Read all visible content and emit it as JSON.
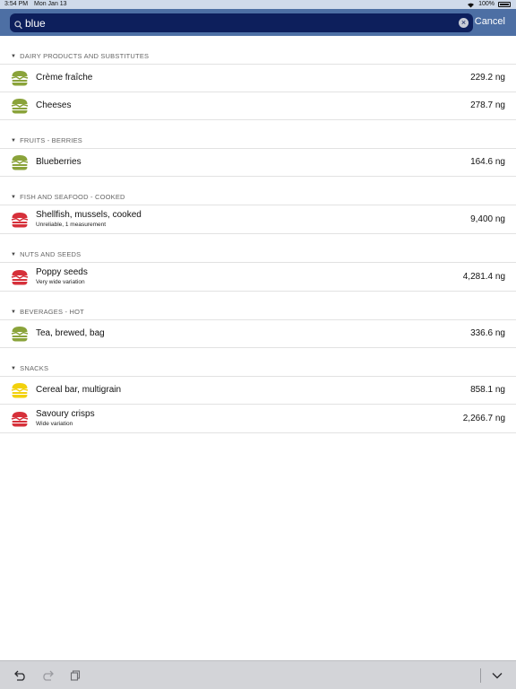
{
  "status": {
    "time": "3:54 PM",
    "date": "Mon Jan 13",
    "battery": "100%"
  },
  "search": {
    "query": "blue",
    "cancel_label": "Cancel"
  },
  "colors": {
    "nav": "#4d6fa4",
    "search_bg": "#0d1f5c",
    "green": "#8aa33a",
    "red": "#d6303a",
    "yellow": "#f2d10c"
  },
  "sections": [
    {
      "title": "DAIRY PRODUCTS AND SUBSTITUTES",
      "items": [
        {
          "name": "Crème fraîche",
          "sub": "",
          "value": "229.2 ng",
          "icon": "burger-green-icon"
        },
        {
          "name": "Cheeses",
          "sub": "",
          "value": "278.7 ng",
          "icon": "burger-green-icon"
        }
      ]
    },
    {
      "title": "FRUITS - BERRIES",
      "items": [
        {
          "name": "Blueberries",
          "sub": "",
          "value": "164.6 ng",
          "icon": "burger-green-icon"
        }
      ]
    },
    {
      "title": "FISH AND SEAFOOD - COOKED",
      "items": [
        {
          "name": "Shellfish, mussels, cooked",
          "sub": "Unreliable, 1 measurement",
          "value": "9,400 ng",
          "icon": "burger-red-icon"
        }
      ]
    },
    {
      "title": "NUTS AND SEEDS",
      "items": [
        {
          "name": "Poppy seeds",
          "sub": "Very wide variation",
          "value": "4,281.4 ng",
          "icon": "burger-red-icon"
        }
      ]
    },
    {
      "title": "BEVERAGES - HOT",
      "items": [
        {
          "name": "Tea, brewed, bag",
          "sub": "",
          "value": "336.6 ng",
          "icon": "burger-green-icon"
        }
      ]
    },
    {
      "title": "SNACKS",
      "items": [
        {
          "name": "Cereal bar, multigrain",
          "sub": "",
          "value": "858.1 ng",
          "icon": "burger-yellow-icon"
        },
        {
          "name": "Savoury crisps",
          "sub": "Wide variation",
          "value": "2,266.7 ng",
          "icon": "burger-red-icon"
        }
      ]
    }
  ],
  "toolbar": {
    "undo_icon": "undo-icon",
    "redo_icon": "redo-icon",
    "paste_icon": "clipboard-icon",
    "chevron_icon": "chevron-down-icon"
  }
}
